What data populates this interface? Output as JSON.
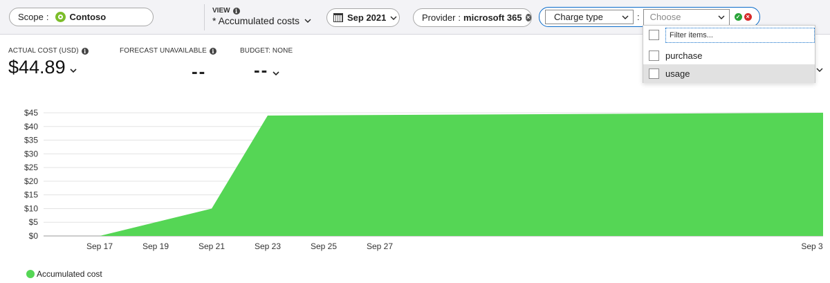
{
  "toolbar": {
    "scope": {
      "label": "Scope",
      "separator": ":",
      "value": "Contoso"
    },
    "view": {
      "label": "VIEW",
      "name": "* Accumulated costs"
    },
    "date": {
      "value": "Sep 2021"
    },
    "provider": {
      "label": "Provider",
      "separator": ":",
      "value": "microsoft 365"
    },
    "filter": {
      "field": "Charge type",
      "separator": ":",
      "value_placeholder": "Choose"
    }
  },
  "dropdown": {
    "filter_placeholder": "Filter items...",
    "options": [
      {
        "label": "purchase",
        "checked": false,
        "highlighted": false
      },
      {
        "label": "usage",
        "checked": false,
        "highlighted": true
      }
    ]
  },
  "kpis": {
    "actual": {
      "label": "ACTUAL COST (USD)",
      "value": "$44.89"
    },
    "forecast": {
      "label": "FORECAST UNAVAILABLE",
      "value": "--"
    },
    "budget": {
      "label": "BUDGET: NONE",
      "value": "--"
    }
  },
  "colors": {
    "accent": "#0a6bc9",
    "series": "#55d655",
    "scope_logo": "#7cbd2a",
    "ok": "#2aa43a",
    "cancel": "#d52a2a"
  },
  "icons": [
    "scope-logo-icon",
    "info-icon",
    "chevron-down-icon",
    "calendar-icon",
    "close-icon",
    "check-icon"
  ],
  "chart_data": {
    "type": "area",
    "x": [
      "Sep 16",
      "Sep 17",
      "Sep 21",
      "Sep 23",
      "Sep 30"
    ],
    "series": [
      {
        "name": "Accumulated cost",
        "values": [
          0,
          0,
          10,
          44,
          45
        ],
        "color": "#55d655"
      }
    ],
    "x_ticks": [
      "Sep 17",
      "Sep 19",
      "Sep 21",
      "Sep 23",
      "Sep 25",
      "Sep 27",
      "Sep 3"
    ],
    "y_ticks": [
      "$0",
      "$5",
      "$10",
      "$15",
      "$20",
      "$25",
      "$30",
      "$35",
      "$40",
      "$45"
    ],
    "ylim": [
      0,
      45
    ],
    "grid": true,
    "legend": "bottom-left",
    "title": "",
    "xlabel": "",
    "ylabel": ""
  }
}
